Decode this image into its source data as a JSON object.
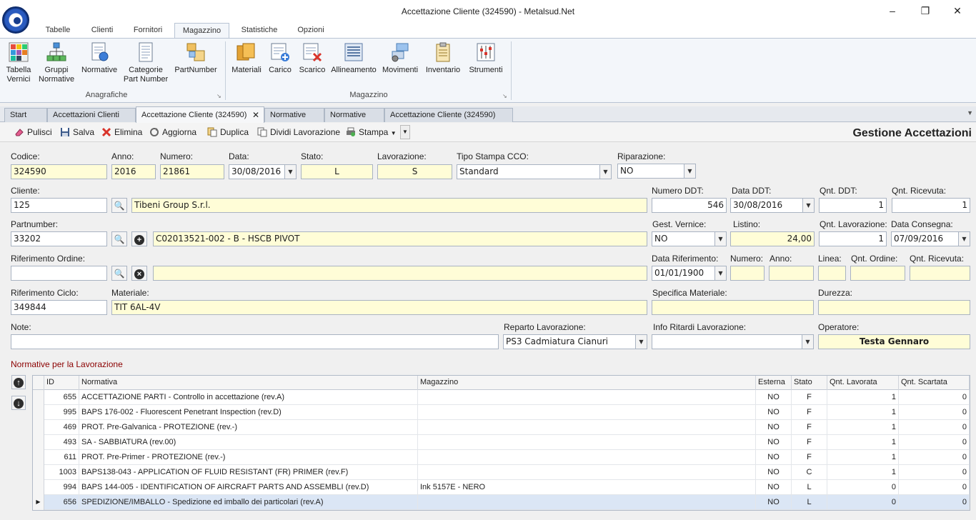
{
  "window": {
    "title": "Accettazione Cliente (324590) - Metalsud.Net"
  },
  "ribbon_tabs": [
    "Tabelle",
    "Clienti",
    "Fornitori",
    "Magazzino",
    "Statistiche",
    "Opzioni"
  ],
  "ribbon": {
    "anagrafiche": {
      "label": "Anagrafiche",
      "buttons": [
        "Tabella\nVernici",
        "Gruppi\nNormative",
        "Normative",
        "Categorie\nPart Number",
        "PartNumber"
      ]
    },
    "magazzino": {
      "label": "Magazzino",
      "buttons": [
        "Materiali",
        "Carico",
        "Scarico",
        "Allineamento",
        "Movimenti",
        "Inventario",
        "Strumenti"
      ]
    }
  },
  "doc_tabs": [
    "Start",
    "Accettazioni Clienti",
    "Accettazione Cliente (324590)",
    "Normative",
    "Normative",
    "Accettazione Cliente (324590)"
  ],
  "toolbar": {
    "pulisci": "Pulisci",
    "salva": "Salva",
    "elimina": "Elimina",
    "aggiorna": "Aggiorna",
    "duplica": "Duplica",
    "dividi": "Dividi Lavorazione",
    "stampa": "Stampa",
    "panel_title": "Gestione Accettazioni"
  },
  "form": {
    "codice": {
      "label": "Codice:",
      "value": "324590"
    },
    "anno": {
      "label": "Anno:",
      "value": "2016"
    },
    "numero": {
      "label": "Numero:",
      "value": "21861"
    },
    "data": {
      "label": "Data:",
      "value": "30/08/2016"
    },
    "stato": {
      "label": "Stato:",
      "value": "L"
    },
    "lavorazione": {
      "label": "Lavorazione:",
      "value": "S"
    },
    "tipo_stampa": {
      "label": "Tipo Stampa CCO:",
      "value": "Standard"
    },
    "riparazione": {
      "label": "Riparazione:",
      "value": "NO"
    },
    "cliente": {
      "label": "Cliente:",
      "code": "125",
      "name": "Tibeni Group S.r.l."
    },
    "numero_ddt": {
      "label": "Numero DDT:",
      "value": "546"
    },
    "data_ddt": {
      "label": "Data DDT:",
      "value": "30/08/2016"
    },
    "qnt_ddt": {
      "label": "Qnt. DDT:",
      "value": "1"
    },
    "qnt_ricevuta": {
      "label": "Qnt. Ricevuta:",
      "value": "1"
    },
    "partnumber": {
      "label": "Partnumber:",
      "code": "33202",
      "desc": "C02013521-002 - B - HSCB PIVOT"
    },
    "gest_vernice": {
      "label": "Gest. Vernice:",
      "value": "NO"
    },
    "listino": {
      "label": "Listino:",
      "value": "24,00"
    },
    "qnt_lavorazione": {
      "label": "Qnt. Lavorazione:",
      "value": "1"
    },
    "data_consegna": {
      "label": "Data Consegna:",
      "value": "07/09/2016"
    },
    "rif_ordine": {
      "label": "Riferimento Ordine:",
      "code": "",
      "desc": ""
    },
    "data_riferimento": {
      "label": "Data Riferimento:",
      "value": "01/01/1900"
    },
    "numero2": {
      "label": "Numero:",
      "value": ""
    },
    "anno2": {
      "label": "Anno:",
      "value": ""
    },
    "linea": {
      "label": "Linea:",
      "value": ""
    },
    "qnt_ordine": {
      "label": "Qnt. Ordine:",
      "value": ""
    },
    "qnt_ricevuta2": {
      "label": "Qnt. Ricevuta:",
      "value": ""
    },
    "rif_ciclo": {
      "label": "Riferimento Ciclo:",
      "value": "349844"
    },
    "materiale": {
      "label": "Materiale:",
      "value": "TIT 6AL-4V"
    },
    "specifica_materiale": {
      "label": "Specifica Materiale:",
      "value": ""
    },
    "durezza": {
      "label": "Durezza:",
      "value": ""
    },
    "note": {
      "label": "Note:",
      "value": ""
    },
    "reparto": {
      "label": "Reparto Lavorazione:",
      "value": "PS3 Cadmiatura Cianuri"
    },
    "info_ritardi": {
      "label": "Info Ritardi Lavorazione:",
      "value": ""
    },
    "operatore": {
      "label": "Operatore:",
      "value": "Testa Gennaro"
    }
  },
  "normative_section": {
    "title": "Normative per la Lavorazione",
    "columns": [
      "ID",
      "Normativa",
      "Magazzino",
      "Esterna",
      "Stato",
      "Qnt. Lavorata",
      "Qnt. Scartata"
    ],
    "rows": [
      {
        "id": "655",
        "normativa": "ACCETTAZIONE PARTI - Controllo in accettazione (rev.A)",
        "magazzino": "",
        "esterna": "NO",
        "stato": "F",
        "lavorata": "1",
        "scartata": "0"
      },
      {
        "id": "995",
        "normativa": "BAPS 176-002 - Fluorescent Penetrant Inspection (rev.D)",
        "magazzino": "",
        "esterna": "NO",
        "stato": "F",
        "lavorata": "1",
        "scartata": "0"
      },
      {
        "id": "469",
        "normativa": "PROT.  Pre-Galvanica - PROTEZIONE (rev.-)",
        "magazzino": "",
        "esterna": "NO",
        "stato": "F",
        "lavorata": "1",
        "scartata": "0"
      },
      {
        "id": "493",
        "normativa": "SA - SABBIATURA (rev.00)",
        "magazzino": "",
        "esterna": "NO",
        "stato": "F",
        "lavorata": "1",
        "scartata": "0"
      },
      {
        "id": "611",
        "normativa": "PROT.  Pre-Primer - PROTEZIONE (rev.-)",
        "magazzino": "",
        "esterna": "NO",
        "stato": "F",
        "lavorata": "1",
        "scartata": "0"
      },
      {
        "id": "1003",
        "normativa": "BAPS138-043 - APPLICATION OF FLUID RESISTANT (FR) PRIMER (rev.F)",
        "magazzino": "",
        "esterna": "NO",
        "stato": "C",
        "lavorata": "1",
        "scartata": "0"
      },
      {
        "id": "994",
        "normativa": "BAPS 144-005 - IDENTIFICATION OF AIRCRAFT PARTS AND ASSEMBLI (rev.D)",
        "magazzino": "Ink 5157E - NERO",
        "esterna": "NO",
        "stato": "L",
        "lavorata": "0",
        "scartata": "0"
      },
      {
        "id": "656",
        "normativa": "SPEDIZIONE/IMBALLO - Spedizione ed imballo dei particolari (rev.A)",
        "magazzino": "",
        "esterna": "NO",
        "stato": "L",
        "lavorata": "0",
        "scartata": "0"
      }
    ]
  }
}
